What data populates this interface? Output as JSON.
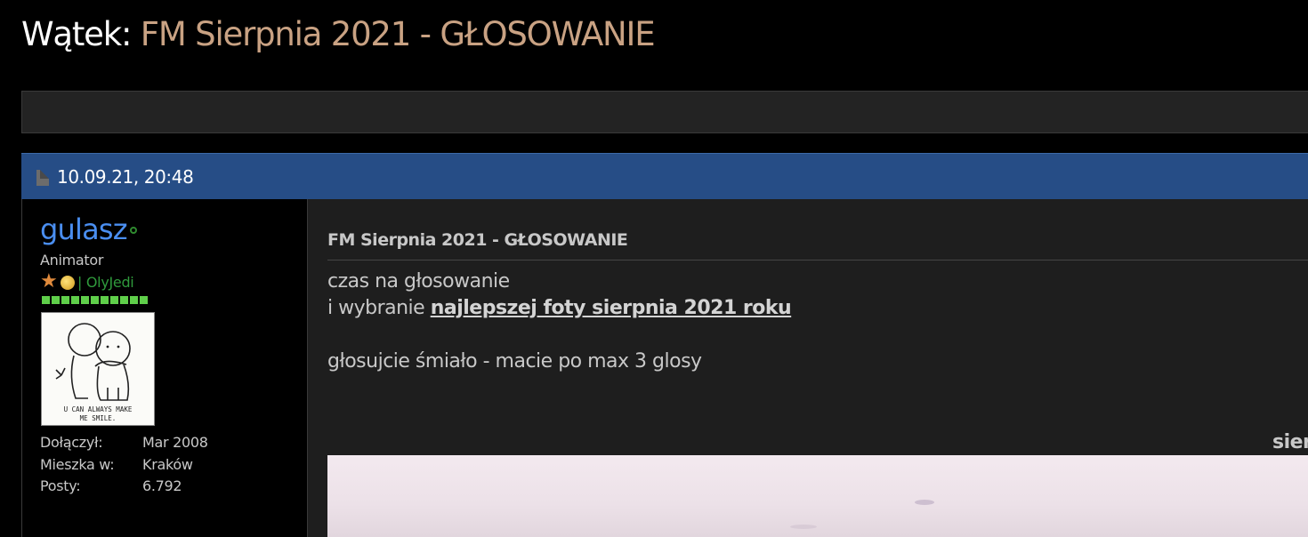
{
  "thread": {
    "prefix": "Wątek:",
    "title": "FM Sierpnia 2021 - GŁOSOWANIE"
  },
  "post": {
    "date": "10.09.21, 20:48",
    "title": "FM Sierpnia 2021 - GŁOSOWANIE",
    "line1": "czas na głosowanie",
    "line2_prefix": "i wybranie ",
    "line2_link": "najlepszej foty sierpnia 2021 roku",
    "line3": "głosujcie śmiało - macie po max 3 glosy",
    "cut_heading": "sierpień"
  },
  "user": {
    "name": "gulasz",
    "title": "Animator",
    "award_label": "| OlyJedi",
    "reputation_level_fraction": 1.0,
    "reputation_segments": 11,
    "avatar_caption_1": "U CAN ALWAYS MAKE",
    "avatar_caption_2": "ME SMILE.",
    "info": {
      "joined_label": "Dołączył:",
      "joined_value": "Mar 2008",
      "location_label": "Mieszka w:",
      "location_value": "Kraków",
      "posts_label": "Posty:",
      "posts_value": "6.792"
    }
  },
  "colors": {
    "background": "#000000",
    "header_bar": "#264d86",
    "username": "#4a8ef0",
    "thread_title": "#c9a283",
    "online": "#2f8a2f",
    "reputation": "#5fcf4a"
  },
  "icons": {
    "post": "post-page-icon",
    "online": "online-status-icon",
    "award_star": "star-award-icon",
    "award_medal": "medal-award-icon"
  }
}
